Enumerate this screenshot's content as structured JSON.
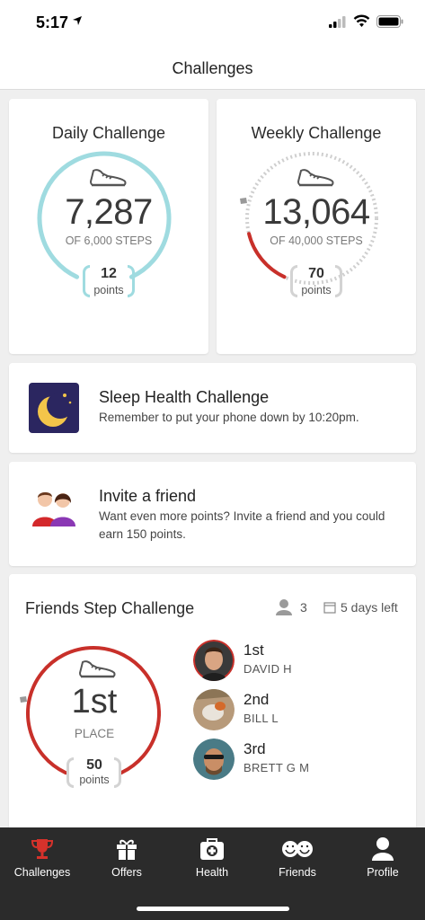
{
  "status_bar": {
    "time": "5:17"
  },
  "nav": {
    "title": "Challenges"
  },
  "daily": {
    "title": "Daily Challenge",
    "steps": "7,287",
    "goal": "OF 6,000 STEPS",
    "points": "12",
    "points_label": "points",
    "progress": 1.0,
    "ring_color": "#9fdbe0"
  },
  "weekly": {
    "title": "Weekly Challenge",
    "steps": "13,064",
    "goal": "OF 40,000 STEPS",
    "points": "70",
    "points_label": "points",
    "progress": 0.33,
    "ring_color": "#c8302a",
    "track_color": "#cfcfcf"
  },
  "sleep": {
    "title": "Sleep Health Challenge",
    "description": "Remember to put your phone down by 10:20pm."
  },
  "invite": {
    "title": "Invite a friend",
    "description": "Want even more points? Invite a friend and you could earn 150 points."
  },
  "friends": {
    "title": "Friends Step Challenge",
    "participants": "3",
    "days_left": "5 days left",
    "place": "1st",
    "place_label": "PLACE",
    "points": "50",
    "points_label": "points",
    "ring_color": "#c8302a",
    "leaderboard": [
      {
        "place": "1st",
        "name": "DAVID H"
      },
      {
        "place": "2nd",
        "name": "BILL L"
      },
      {
        "place": "3rd",
        "name": "BRETT G M"
      }
    ]
  },
  "tabs": [
    {
      "label": "Challenges",
      "icon": "trophy-icon",
      "active": true
    },
    {
      "label": "Offers",
      "icon": "gift-icon",
      "active": false
    },
    {
      "label": "Health",
      "icon": "medical-kit-icon",
      "active": false
    },
    {
      "label": "Friends",
      "icon": "friends-icon",
      "active": false
    },
    {
      "label": "Profile",
      "icon": "person-icon",
      "active": false
    }
  ],
  "colors": {
    "accent_red": "#c8302a",
    "accent_teal": "#9fdbe0",
    "tabbar": "#2b2b2b"
  }
}
